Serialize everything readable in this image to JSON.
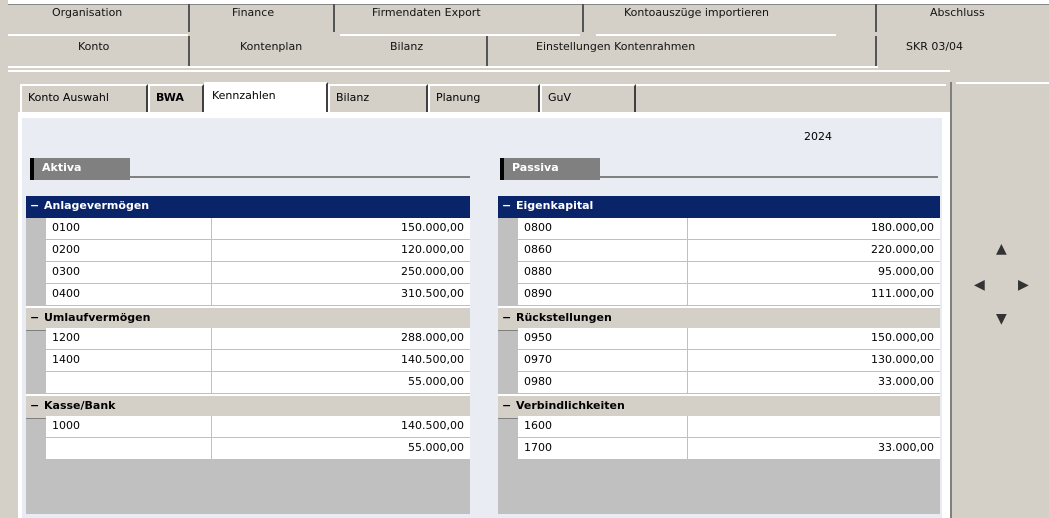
{
  "top_tabs_row1": [
    "Organisation",
    "Finance",
    "Firmendaten Export",
    "Kontoauszüge importieren",
    "Abschluss"
  ],
  "top_tabs_row2": [
    "Konto",
    "Kontenplan",
    "Bilanz",
    "Einstellungen Kontenrahmen",
    "SKR 03/04"
  ],
  "page_tabs": {
    "items": [
      "Konto Auswahl",
      "BWA",
      "Kennzahlen",
      "Bilanz",
      "Planung",
      "GuV"
    ],
    "active_index": 2
  },
  "period_label": "2024",
  "left_group": {
    "title": "Aktiva",
    "sections": [
      {
        "header": "Anlagevermögen",
        "style": "selected",
        "rows": [
          {
            "label": "0100",
            "value": "150.000,00"
          },
          {
            "label": "0200",
            "value": "120.000,00"
          },
          {
            "label": "0300",
            "value": "250.000,00"
          },
          {
            "label": "0400",
            "value": "310.500,00"
          }
        ]
      },
      {
        "header": "Umlaufvermögen",
        "style": "category",
        "rows": [
          {
            "label": "1200",
            "value": "288.000,00"
          },
          {
            "label": "1400",
            "value": "140.500,00"
          },
          {
            "label": "",
            "value": "55.000,00"
          }
        ]
      },
      {
        "header": "Kasse/Bank",
        "style": "category",
        "rows": [
          {
            "label": "1000",
            "value": "140.500,00"
          },
          {
            "label": "",
            "value": "55.000,00"
          }
        ]
      }
    ]
  },
  "right_group": {
    "title": "Passiva",
    "sections": [
      {
        "header": "Eigenkapital",
        "style": "selected",
        "rows": [
          {
            "label": "0800",
            "value": "180.000,00"
          },
          {
            "label": "0860",
            "value": "220.000,00"
          },
          {
            "label": "0880",
            "value": "95.000,00"
          },
          {
            "label": "0890",
            "value": "111.000,00"
          }
        ]
      },
      {
        "header": "Rückstellungen",
        "style": "category",
        "rows": [
          {
            "label": "0950",
            "value": "150.000,00"
          },
          {
            "label": "0970",
            "value": "130.000,00"
          },
          {
            "label": "0980",
            "value": "33.000,00"
          }
        ]
      },
      {
        "header": "Verbindlichkeiten",
        "style": "category",
        "rows": [
          {
            "label": "1600",
            "value": ""
          },
          {
            "label": "1700",
            "value": "33.000,00"
          }
        ]
      }
    ]
  },
  "scroll_controls": {
    "up": "▲",
    "left": "◀",
    "right": "▶",
    "down": "▼"
  }
}
